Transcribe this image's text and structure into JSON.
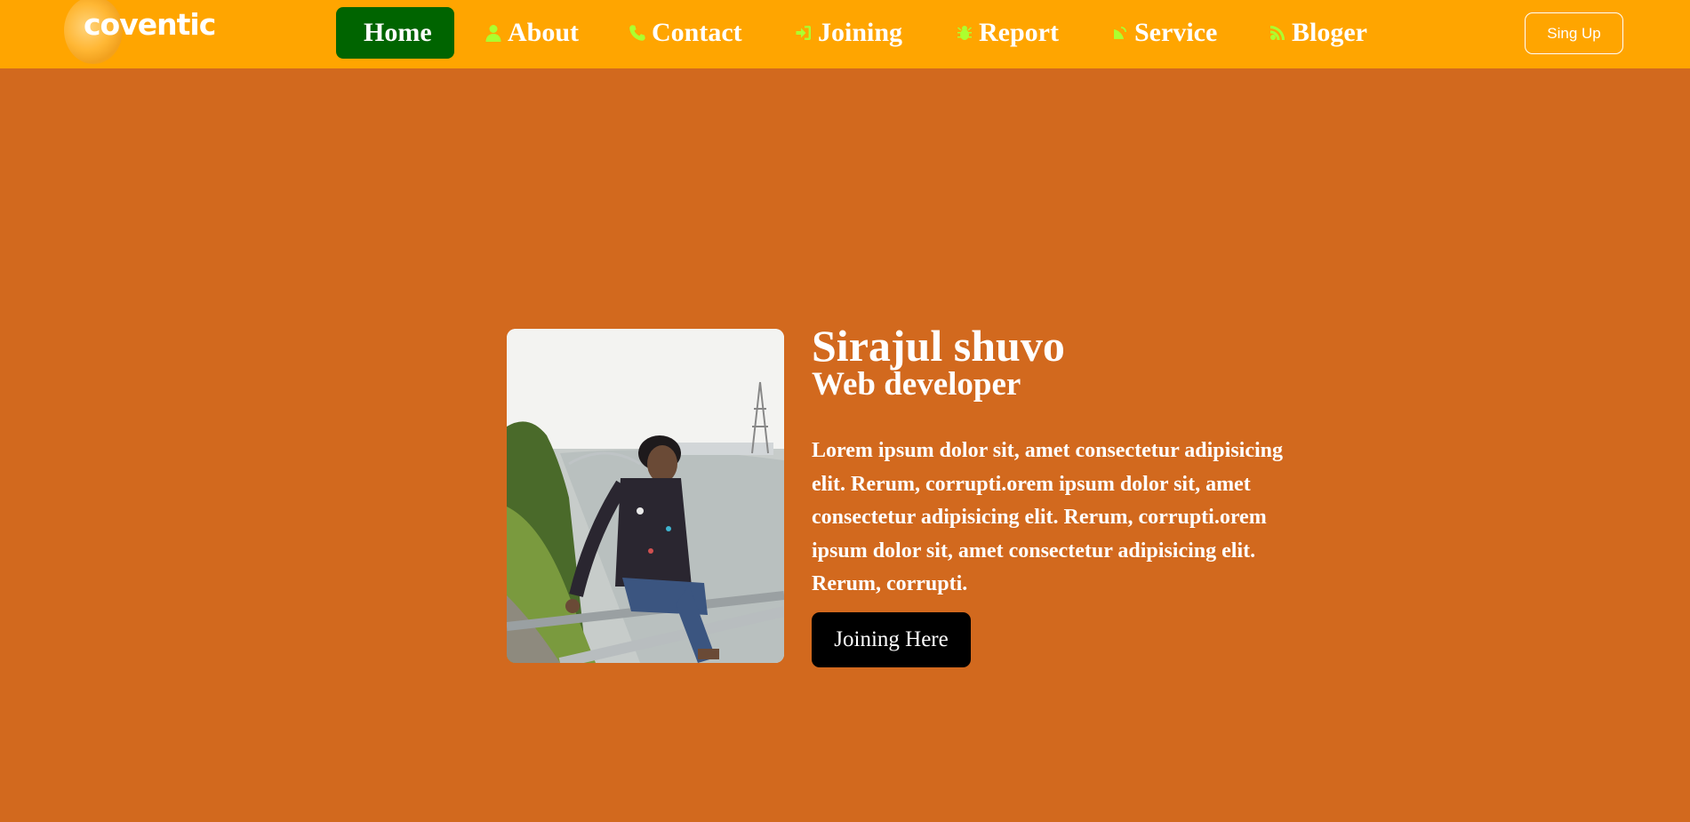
{
  "brand": {
    "logo_text": "coventic"
  },
  "nav": {
    "items": [
      {
        "label": "Home",
        "icon": "none",
        "active": true
      },
      {
        "label": "About",
        "icon": "user-icon"
      },
      {
        "label": "Contact",
        "icon": "phone-icon"
      },
      {
        "label": "Joining",
        "icon": "sign-in-icon"
      },
      {
        "label": "Report",
        "icon": "bug-icon"
      },
      {
        "label": "Service",
        "icon": "satellite-dish-icon"
      },
      {
        "label": "Blogger",
        "icon": "blog-icon",
        "display": "Bloger"
      }
    ],
    "signup_label": "Sing Up"
  },
  "hero": {
    "name": "Sirajul shuvo",
    "role": "Web developer",
    "description": "Lorem ipsum dolor sit, amet consectetur adipisicing elit. Rerum, corrupti.orem ipsum dolor sit, amet consectetur adipisicing elit. Rerum, corrupti.orem ipsum dolor sit, amet consectetur adipisicing elit. Rerum, corrupti.",
    "cta_label": "Joining Here"
  },
  "colors": {
    "navbar": "#ffa500",
    "page_background": "#d2691e",
    "active_nav": "#006400",
    "nav_icon": "#adff2f",
    "cta_background": "#000000"
  }
}
